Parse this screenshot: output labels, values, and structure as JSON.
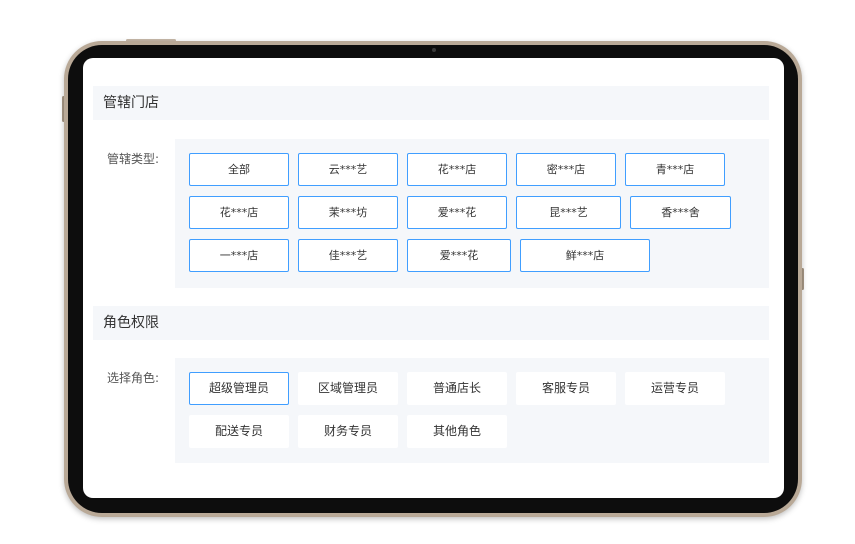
{
  "stores_section": {
    "title": "管辖门店",
    "type_label": "管辖类型:",
    "options": [
      {
        "label": "全部"
      },
      {
        "label": "云***艺"
      },
      {
        "label": "花***店"
      },
      {
        "label": "密***店"
      },
      {
        "label": "青***店"
      },
      {
        "label": "花***店"
      },
      {
        "label": "茉***坊"
      },
      {
        "label": "爱***花"
      },
      {
        "label": "昆***艺"
      },
      {
        "label": "香***舍"
      },
      {
        "label": "一***店"
      },
      {
        "label": "佳***艺"
      },
      {
        "label": "爱***花"
      },
      {
        "label": "鲜***店"
      }
    ]
  },
  "roles_section": {
    "title": "角色权限",
    "role_label": "选择角色:",
    "selected": "超级管理员",
    "options": [
      {
        "label": "超级管理员"
      },
      {
        "label": "区域管理员"
      },
      {
        "label": "普通店长"
      },
      {
        "label": "客服专员"
      },
      {
        "label": "运营专员"
      },
      {
        "label": "配送专员"
      },
      {
        "label": "财务专员"
      },
      {
        "label": "其他角色"
      }
    ]
  },
  "colors": {
    "accent": "#409eff",
    "panel_bg": "#f5f7fa",
    "device_frame": "#b9a997"
  }
}
